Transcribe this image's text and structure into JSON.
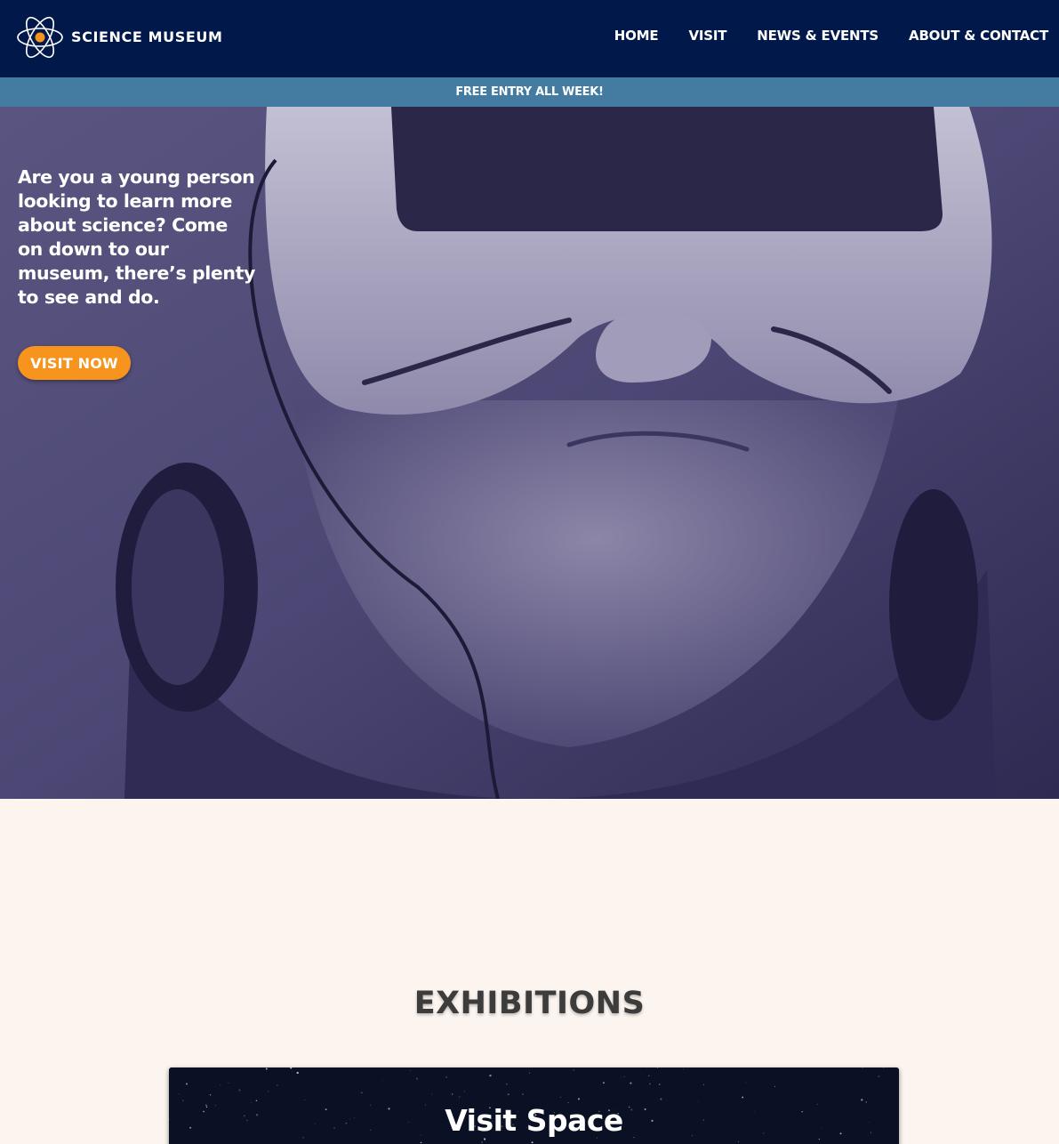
{
  "header": {
    "brand": "SCIENCE MUSEUM",
    "logo_icon": "atom-icon",
    "nav": [
      "HOME",
      "VISIT",
      "NEWS & EVENTS",
      "ABOUT & CONTACT"
    ]
  },
  "banner": {
    "text": "FREE ENTRY ALL WEEK!"
  },
  "hero": {
    "text": "Are you a young person looking to learn more about science? Come on down to our museum, there’s plenty to see and do.",
    "button_label": "VISIT NOW",
    "image": "person-wearing-vr-headset-photo"
  },
  "exhibitions": {
    "title": "EXHIBITIONS",
    "cards": [
      {
        "title": "Visit Space"
      }
    ]
  },
  "colors": {
    "header_bg": "#01184a",
    "banner_bg": "#437ba1",
    "accent": "#f7941d",
    "page_bg": "#fcf5ef"
  }
}
